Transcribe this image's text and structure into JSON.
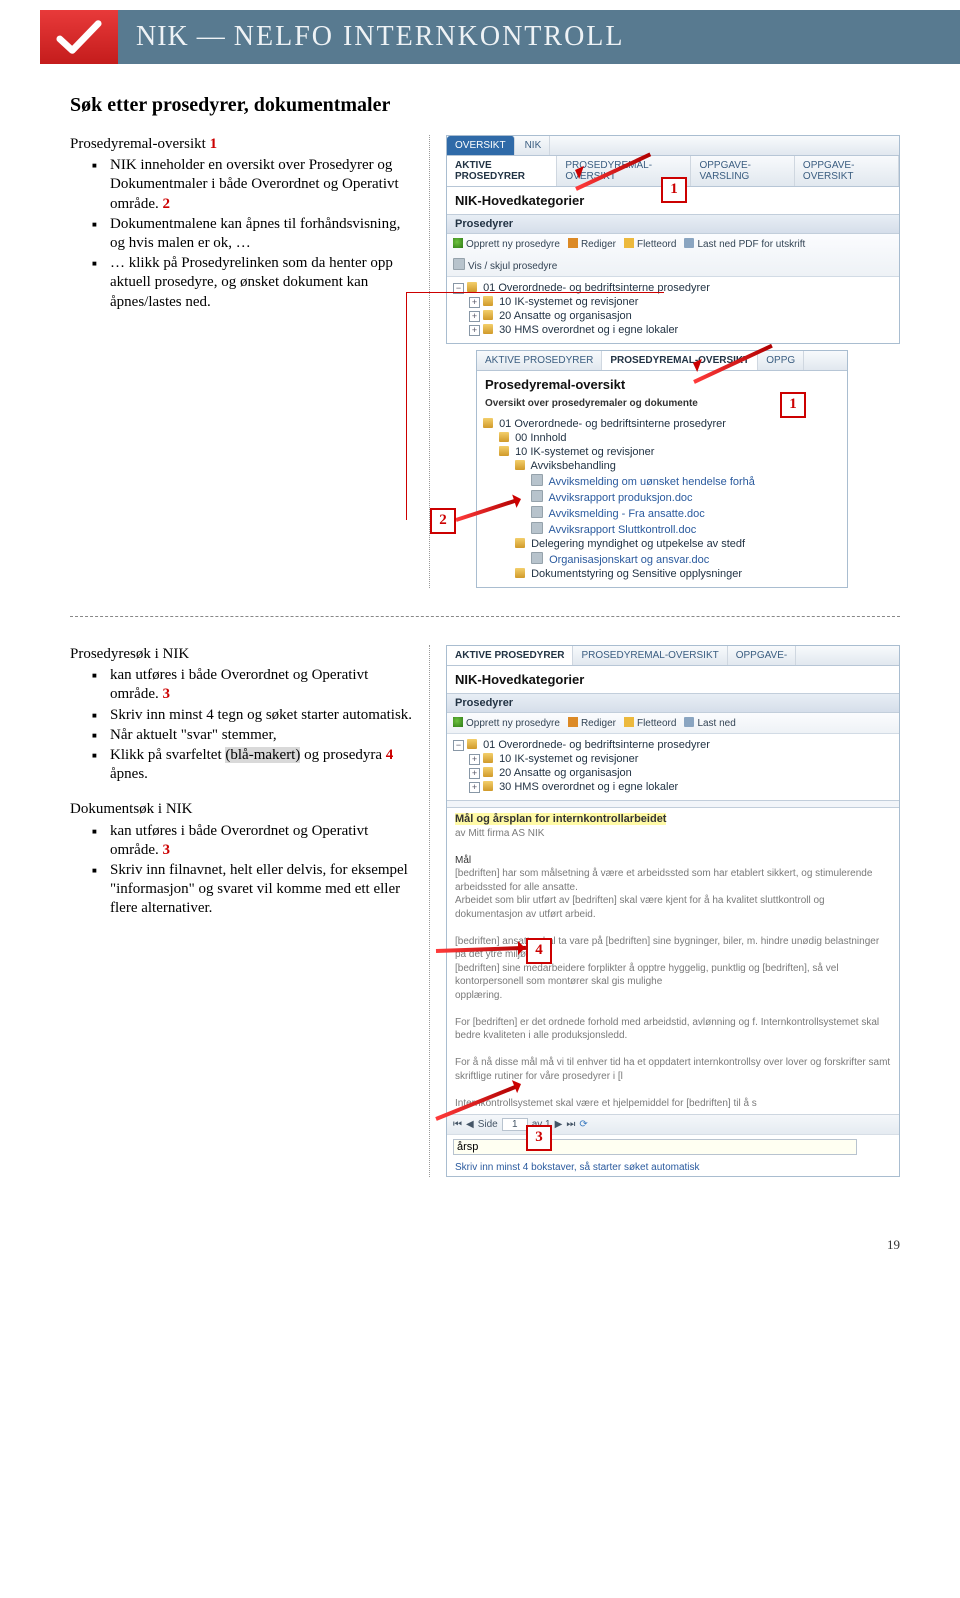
{
  "logo": {
    "brand": "NIK",
    "sub": "NELFO INTERNKONTROLL"
  },
  "section1": {
    "heading": "Søk etter prosedyrer, dokumentmaler",
    "subhead": "Prosedyremal-oversikt",
    "bullets": {
      "b1_pre": "NIK inneholder en oversikt over Prosedyrer og Dokumentmaler i både Overordnet og Operativt område. ",
      "b2_pre": "Dokumentmalene kan åpnes til forhåndsvisning, og hvis malen er ok, …",
      "b3": "… klikk på Prosedyrelinken som da henter opp aktuell prosedyre, og ønsket dokument kan åpnes/lastes ned."
    }
  },
  "shot1": {
    "tabs": {
      "t1": "OVERSIKT",
      "t2": "NIK"
    },
    "subtabs": {
      "a": "AKTIVE PROSEDYRER",
      "b": "PROSEDYREMAL-OVERSIKT",
      "c": "OPPGAVE-VARSLING",
      "d": "OPPGAVE-OVERSIKT"
    },
    "title": "NIK-Hovedkategorier",
    "panel": "Prosedyrer",
    "toolbar": {
      "a": "Opprett ny prosedyre",
      "b": "Rediger",
      "c": "Fletteord",
      "d": "Last ned PDF for utskrift",
      "e": "Vis / skjul prosedyre"
    },
    "tree": {
      "n1": "01 Overordnede- og bedriftsinterne prosedyrer",
      "n2": "10 IK-systemet og revisjoner",
      "n3": "20 Ansatte og organisasjon",
      "n4": "30 HMS overordnet og i egne lokaler"
    }
  },
  "shot2": {
    "subtabs": {
      "a": "AKTIVE PROSEDYRER",
      "b": "PROSEDYREMAL-OVERSIKT",
      "c": "OPPG"
    },
    "title": "Prosedyremal-oversikt",
    "desc": "Oversikt over prosedyremaler og dokumente",
    "tree": {
      "f1": "01 Overordnede- og bedriftsinterne prosedyrer",
      "f2": "00 Innhold",
      "f3": "10 IK-systemet og revisjoner",
      "f4": "Avviksbehandling",
      "d1": "Avviksmelding om uønsket hendelse forhå",
      "d2": "Avviksrapport produksjon.doc",
      "d3": "Avviksmelding - Fra ansatte.doc",
      "d4": "Avviksrapport Sluttkontroll.doc",
      "f5": "Delegering myndighet og utpekelse av stedf",
      "d5": "Organisasjonskart og ansvar.doc",
      "f6": "Dokumentstyring og Sensitive opplysninger"
    }
  },
  "section2": {
    "h1": "Prosedyresøk i NIK",
    "b1_pre": "kan utføres i både Overordnet og Operativt område. ",
    "b2": "Skriv inn minst 4 tegn og søket starter automatisk.",
    "b3": "Når aktuelt \"svar\" stemmer,",
    "b4_a": "Klikk på svarfeltet ",
    "b4_h": "(blå-makert)",
    "b4_b": " og prosedyra ",
    "b4_c": " åpnes.",
    "h2": "Dokumentsøk i NIK",
    "b5_pre": "kan utføres i både Overordnet og Operativt område. ",
    "b6": "Skriv inn filnavnet, helt eller delvis, for eksempel \"informasjon\" og svaret vil komme med ett eller flere alternativer."
  },
  "shot3": {
    "subtabs": {
      "a": "AKTIVE PROSEDYRER",
      "b": "PROSEDYREMAL-OVERSIKT",
      "c": "OPPGAVE-"
    },
    "title": "NIK-Hovedkategorier",
    "panel": "Prosedyrer",
    "toolbar": {
      "a": "Opprett ny prosedyre",
      "b": "Rediger",
      "c": "Fletteord",
      "d": "Last ned"
    },
    "tree": {
      "n1": "01 Overordnede- og bedriftsinterne prosedyrer",
      "n2": "10 IK-systemet og revisjoner",
      "n3": "20 Ansatte og organisasjon",
      "n4": "30 HMS overordnet og i egne lokaler"
    },
    "doc": {
      "title": "Mål og årsplan for internkontrollarbeidet",
      "sub": "av Mitt firma AS NIK",
      "h1": "Mål",
      "p1": "[bedriften] har som målsetning å være et arbeidssted som har etablert sikkert, og stimulerende arbeidssted for alle ansatte.",
      "p1b": "Arbeidet som blir utført av [bedriften] skal være kjent for å ha kvalitet sluttkontroll og dokumentasjon av utført arbeid.",
      "p2": "[bedriften] ansatte skal ta vare på [bedriften] sine bygninger, biler, m. hindre unødig belastninger på det ytre miljø.",
      "p2b": "[bedriften] sine medarbeidere forplikter å opptre hyggelig, punktlig og [bedriften], så vel kontorpersonell som montører skal gis mulighe",
      "p2c": "opplæring.",
      "p3": "For [bedriften] er det ordnede forhold med arbeidstid, avlønning og f. Internkontrollsystemet skal bedre kvaliteten i alle produksjonsledd.",
      "p4": "For å nå disse mål må vi til enhver tid ha et oppdatert internkontrollsy over lover og forskrifter samt skriftlige rutiner for våre prosedyrer i [l",
      "p5": "Internkontrollsystemet skal være et hjelpemiddel for [bedriften] til å s"
    },
    "pager": {
      "side": "Side",
      "page": "1",
      "of": "av 1"
    },
    "search": {
      "value": "årsp",
      "hint": "Skriv inn minst 4 bokstaver, så starter søket automatisk"
    }
  },
  "nums": {
    "n1": "1",
    "n2": "2",
    "n3": "3",
    "n4": "4"
  },
  "pagenum": "19"
}
